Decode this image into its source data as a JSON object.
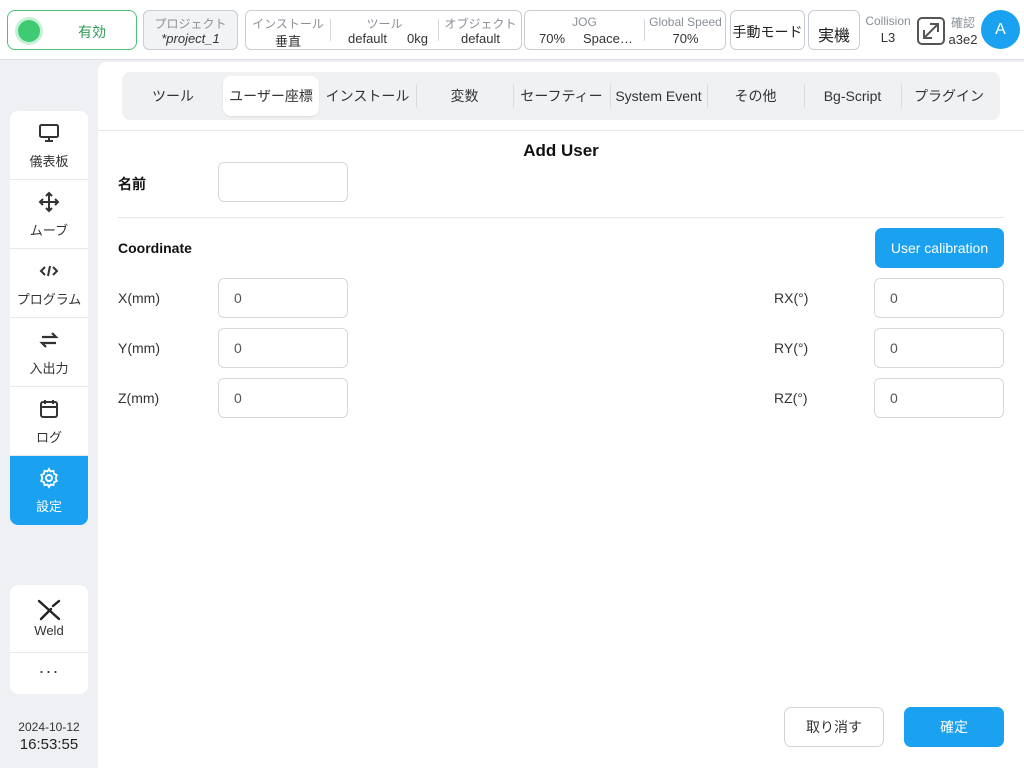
{
  "topbar": {
    "enable_label": "有効",
    "project_caption": "プロジェクト",
    "project_name": "*project_1",
    "install_caption": "インストール",
    "install_value": "垂直",
    "tool_caption": "ツール",
    "tool_name": "default",
    "tool_load": "0kg",
    "object_caption": "オブジェクト",
    "object_value": "default",
    "jog_caption": "JOG",
    "jog_value": "70%",
    "jog_space": "Space…",
    "global_speed_caption": "Global Speed",
    "global_speed_value": "70%",
    "manual_mode": "手動モード",
    "real_machine": "実機",
    "collision_caption": "Collision",
    "collision_value": "L3",
    "confirm_caption": "確認",
    "confirm_value": "a3e2",
    "avatar_letter": "A"
  },
  "sidebar": {
    "items": [
      {
        "label": "儀表板",
        "icon": "monitor-icon"
      },
      {
        "label": "ムーブ",
        "icon": "move-arrows-icon"
      },
      {
        "label": "プログラム",
        "icon": "code-icon"
      },
      {
        "label": "入出力",
        "icon": "swap-icon"
      },
      {
        "label": "ログ",
        "icon": "calendar-icon"
      },
      {
        "label": "設定",
        "icon": "gear-icon",
        "active": true
      }
    ],
    "weld_label": "Weld",
    "more_label": "···",
    "date": "2024-10-12",
    "time": "16:53:55"
  },
  "tabs": [
    {
      "label": "ツール"
    },
    {
      "label": "ユーザー座標",
      "active": true
    },
    {
      "label": "インストール"
    },
    {
      "label": "変数"
    },
    {
      "label": "セーフティー"
    },
    {
      "label": "System Event"
    },
    {
      "label": "その他"
    },
    {
      "label": "Bg-Script"
    },
    {
      "label": "プラグイン"
    }
  ],
  "form": {
    "title": "Add User",
    "name_label": "名前",
    "name_value": "",
    "coordinate_label": "Coordinate",
    "calibration_button": "User calibration",
    "x_label": "X(mm)",
    "x_value": "0",
    "y_label": "Y(mm)",
    "y_value": "0",
    "z_label": "Z(mm)",
    "z_value": "0",
    "rx_label": "RX(°)",
    "rx_value": "0",
    "ry_label": "RY(°)",
    "ry_value": "0",
    "rz_label": "RZ(°)",
    "rz_value": "0",
    "cancel_button": "取り消す",
    "ok_button": "確定"
  },
  "colors": {
    "accent": "#1aa1f0",
    "enable_green": "#3fca74"
  }
}
